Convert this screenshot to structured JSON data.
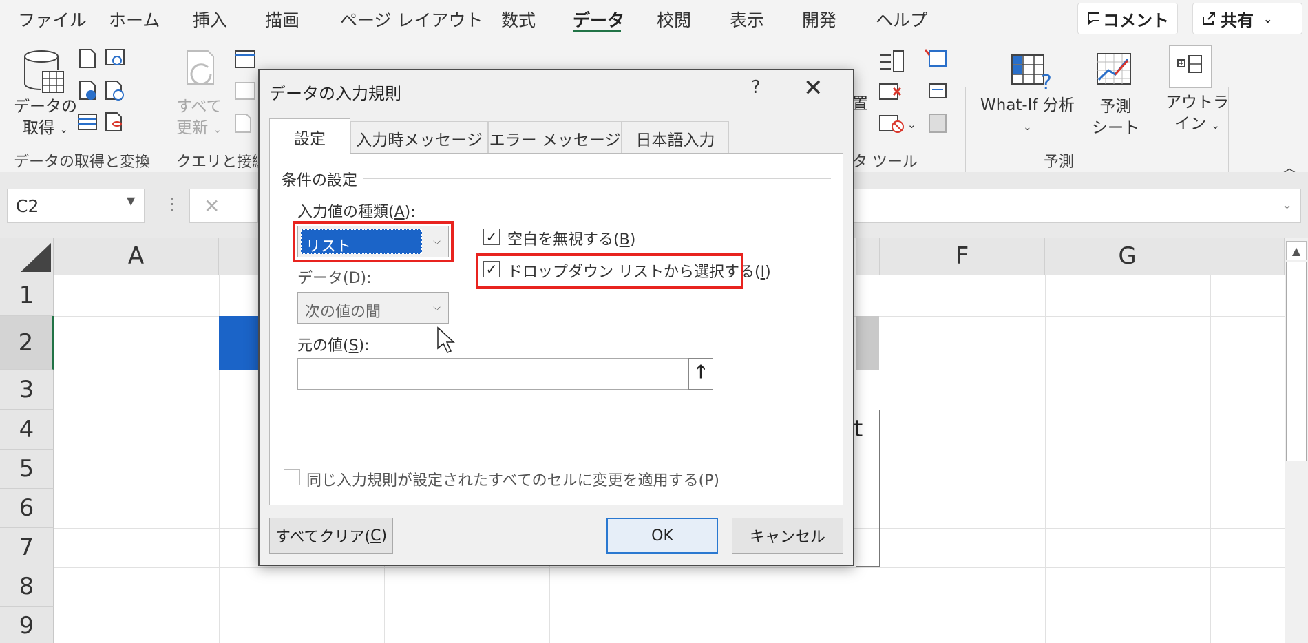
{
  "menu": {
    "tabs": [
      "ファイル",
      "ホーム",
      "挿入",
      "描画",
      "ページ レイアウト",
      "数式",
      "データ",
      "校閲",
      "表示",
      "開発",
      "ヘルプ"
    ],
    "active_index": 6,
    "comment_label": "コメント",
    "share_label": "共有"
  },
  "ribbon": {
    "get_data_label_1": "データの",
    "get_data_label_2": "取得",
    "refresh_all_1": "すべて",
    "refresh_all_2": "更新",
    "text_fragment": "置",
    "whatif_label": "What-If 分析",
    "forecast_sheet_1": "予測",
    "forecast_sheet_2": "シート",
    "outline_1": "アウトラ",
    "outline_2": "イン",
    "groups": {
      "get_transform": "データの取得と変換",
      "queries": "クエリと接続",
      "data_tools": "タ ツール",
      "forecast": "予測"
    }
  },
  "formula_bar": {
    "name_box": "C2",
    "cancel_symbol": "✕"
  },
  "grid": {
    "columns": [
      "A",
      "F",
      "G"
    ],
    "rows": [
      "1",
      "2",
      "3",
      "4",
      "5",
      "6",
      "7",
      "8",
      "9"
    ],
    "partial_text": "t"
  },
  "dialog": {
    "title": "データの入力規則",
    "help": "?",
    "close": "✕",
    "tabs": [
      "設定",
      "入力時メッセージ",
      "エラー メッセージ",
      "日本語入力"
    ],
    "active_tab": 0,
    "group_title": "条件の設定",
    "allow_label": "入力値の種類(",
    "allow_key": "A",
    "allow_label_end": "):",
    "allow_value": "リスト",
    "data_label": "データ(D):",
    "data_value": "次の値の間",
    "ignore_blank_label": "空白を無視する(",
    "ignore_blank_key": "B",
    "ignore_blank_end": ")",
    "ignore_blank_checked": true,
    "in_cell_dropdown_label": "ドロップダウン リストから選択する(",
    "in_cell_dropdown_key": "I",
    "in_cell_dropdown_end": ")",
    "in_cell_dropdown_checked": true,
    "source_label": "元の値(",
    "source_key": "S",
    "source_label_end": "):",
    "source_value": "",
    "apply_all_label": "同じ入力規則が設定されたすべてのセルに変更を適用する(P)",
    "apply_all_checked": false,
    "clear_all_label": "すべてクリア(",
    "clear_all_key": "C",
    "clear_all_end": ")",
    "ok_label": "OK",
    "cancel_label": "キャンセル"
  }
}
